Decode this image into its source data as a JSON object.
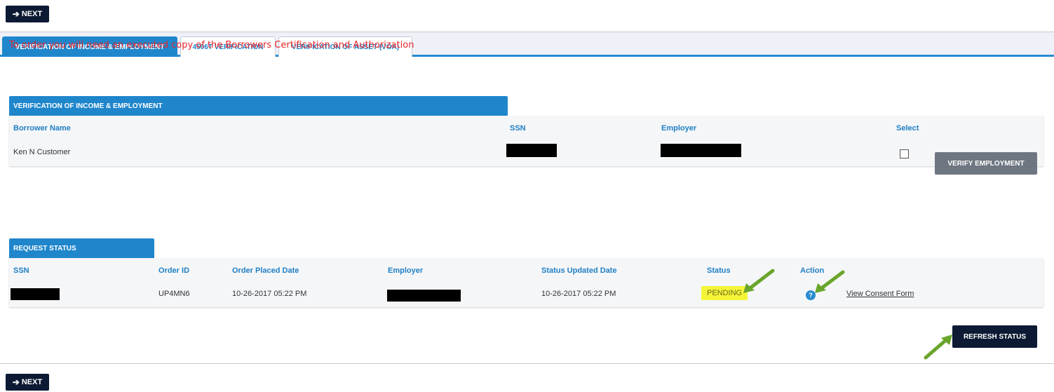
{
  "nav": {
    "next_label": "NEXT"
  },
  "tabs": [
    {
      "label": "VERIFICATION OF INCOME & EMPLOYMENT"
    },
    {
      "label": "4506T VERIFICATION"
    },
    {
      "label": "VERIFICATION OF ASSET-(VOA)"
    }
  ],
  "notice": "To order you will need an executed copy of the Borrowers Certification and Authorization",
  "voie": {
    "header": "VERIFICATION OF INCOME & EMPLOYMENT",
    "columns": {
      "borrower_name": "Borrower Name",
      "ssn": "SSN",
      "employer": "Employer",
      "select": "Select"
    },
    "row": {
      "borrower_name": "Ken N Customer",
      "select_checked": false
    },
    "verify_button": "VERIFY EMPLOYMENT"
  },
  "request_status": {
    "header": "REQUEST STATUS",
    "columns": {
      "ssn": "SSN",
      "order_id": "Order ID",
      "order_placed_date": "Order Placed Date",
      "employer": "Employer",
      "status_updated_date": "Status Updated Date",
      "status": "Status",
      "action": "Action"
    },
    "row": {
      "order_id": "UP4MN6",
      "order_placed_date": "10-26-2017 05:22 PM",
      "status_updated_date": "10-26-2017 05:22 PM",
      "status": "PENDING",
      "action_link": "View Consent Form"
    },
    "refresh_button": "REFRESH STATUS"
  },
  "colors": {
    "accent_blue": "#1f86cc",
    "navy": "#0c1a33",
    "notice_red": "#e8262b",
    "pending_yellow": "#f5f538",
    "arrow_green": "#6aa52b"
  }
}
